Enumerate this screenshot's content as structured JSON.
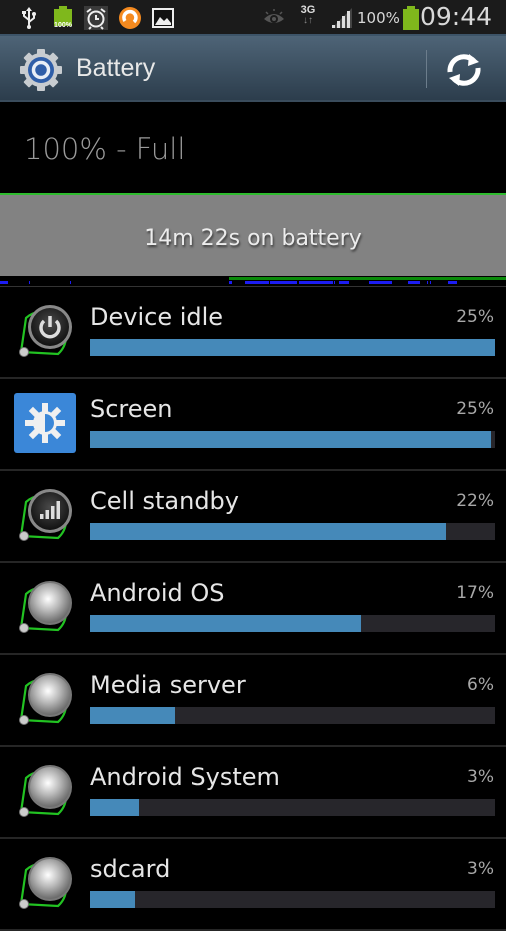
{
  "status_bar": {
    "left_icons": [
      "usb-icon",
      "battery-notification-icon",
      "alarm-icon",
      "app-notification-icon",
      "gallery-icon"
    ],
    "battery_notification_text": "100%",
    "right_icons": [
      "smart-stay-eye-icon",
      "3g-data-icon",
      "signal-icon",
      "battery-icon"
    ],
    "network_type": "3G",
    "battery_percent": "100%",
    "time": "09:44"
  },
  "action_bar": {
    "title": "Battery",
    "app_icon": "settings-gear-icon",
    "refresh_icon": "refresh-icon"
  },
  "battery_level": "100% - Full",
  "history": {
    "label": "14m 22s on battery"
  },
  "usage_list": [
    {
      "name": "Device idle",
      "percent": "25%",
      "bar_fraction": 1.0,
      "icon": "power-icon"
    },
    {
      "name": "Screen",
      "percent": "25%",
      "bar_fraction": 0.99,
      "icon": "brightness-icon"
    },
    {
      "name": "Cell standby",
      "percent": "22%",
      "bar_fraction": 0.88,
      "icon": "signal-bars-icon"
    },
    {
      "name": "Android OS",
      "percent": "17%",
      "bar_fraction": 0.67,
      "icon": "android-process-icon"
    },
    {
      "name": "Media server",
      "percent": "6%",
      "bar_fraction": 0.21,
      "icon": "android-process-icon"
    },
    {
      "name": "Android System",
      "percent": "3%",
      "bar_fraction": 0.12,
      "icon": "android-process-icon"
    },
    {
      "name": "sdcard",
      "percent": "3%",
      "bar_fraction": 0.11,
      "icon": "android-process-icon"
    }
  ],
  "colors": {
    "bar_fill": "#4589b9",
    "bar_track": "#27262b",
    "charging_line": "#2fbc2f",
    "history_bg": "#828282"
  }
}
